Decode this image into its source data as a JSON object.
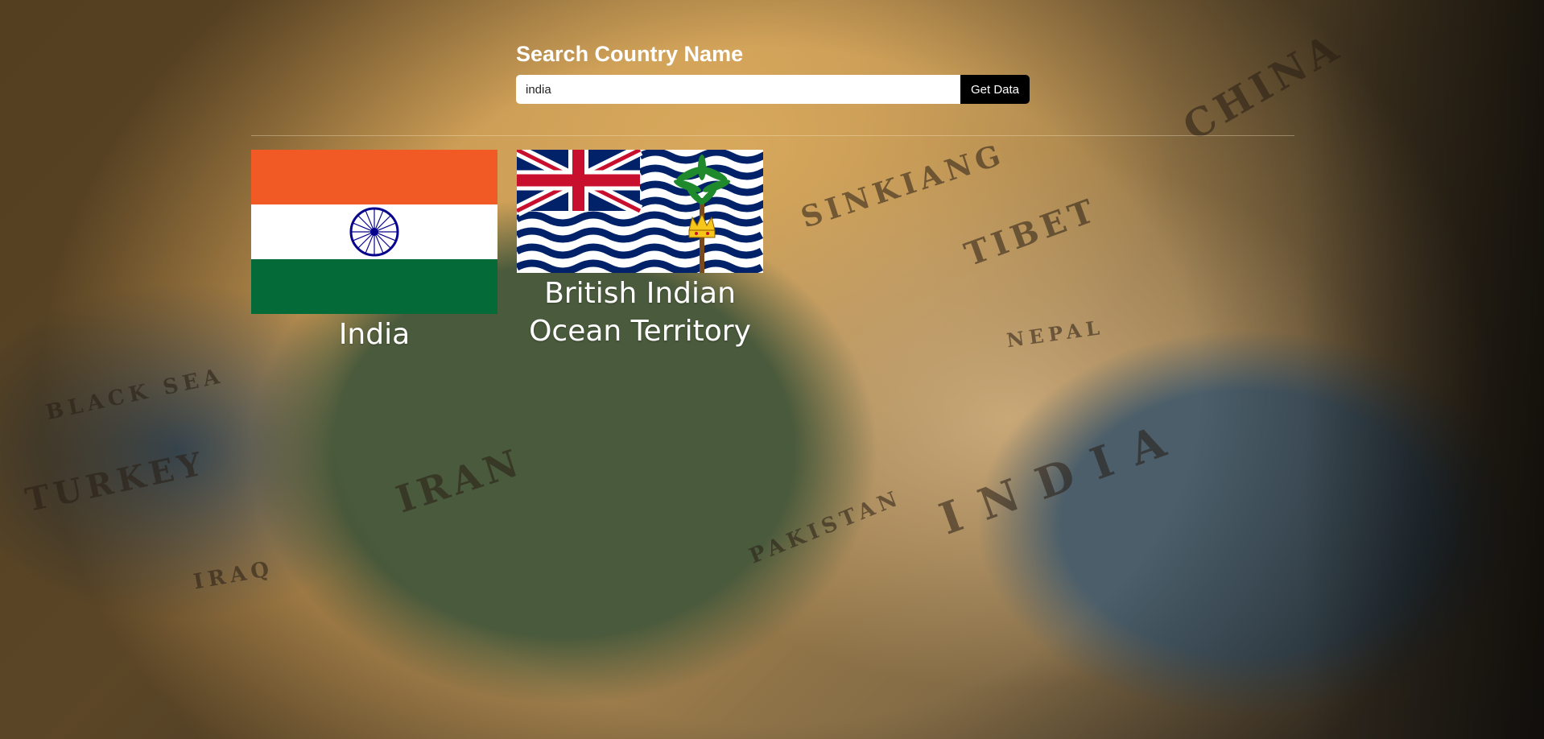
{
  "search": {
    "title": "Search Country Name",
    "input_value": "india",
    "button_label": "Get Data"
  },
  "results": [
    {
      "name": "India",
      "flag_icon": "india-flag-icon"
    },
    {
      "name": "British Indian Ocean Territory",
      "flag_icon": "british-indian-ocean-territory-flag-icon"
    }
  ],
  "background": {
    "map_labels": [
      "TURKEY",
      "IRAN",
      "TIBET",
      "INDIA",
      "PAKISTAN",
      "BLACK SEA",
      "IRAQ",
      "SINKIANG",
      "NEPAL",
      "CHINA"
    ]
  },
  "colors": {
    "india_saffron": "#f15a24",
    "india_green": "#046a38",
    "india_chakra": "#07038d",
    "biot_blue": "#012169",
    "biot_red": "#c8102e",
    "button_bg": "#000000"
  }
}
